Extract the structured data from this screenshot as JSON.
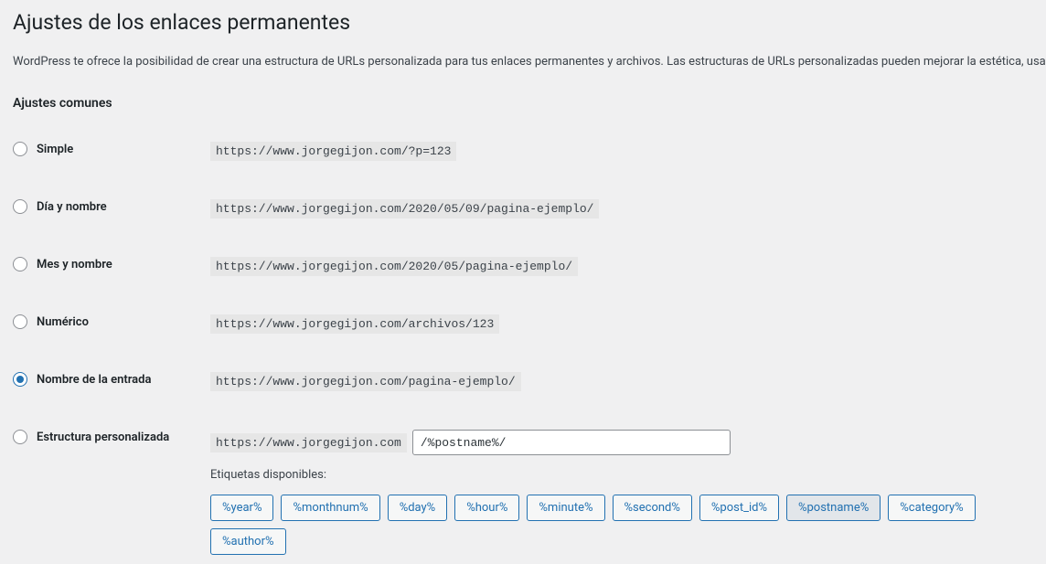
{
  "page": {
    "title": "Ajustes de los enlaces permanentes",
    "description": "WordPress te ofrece la posibilidad de crear una estructura de URLs personalizada para tus enlaces permanentes y archivos. Las estructuras de URLs personalizadas pueden mejorar la estética, usabilidad y compatibilidad futura de tus enlaces. Hay disponibles varias etiquetas, y aquí tienes algunos ejemplos para empezar.",
    "section_title": "Ajustes comunes"
  },
  "options": [
    {
      "label": "Simple",
      "url": "https://www.jorgegijon.com/?p=123",
      "selected": false
    },
    {
      "label": "Día y nombre",
      "url": "https://www.jorgegijon.com/2020/05/09/pagina-ejemplo/",
      "selected": false
    },
    {
      "label": "Mes y nombre",
      "url": "https://www.jorgegijon.com/2020/05/pagina-ejemplo/",
      "selected": false
    },
    {
      "label": "Numérico",
      "url": "https://www.jorgegijon.com/archivos/123",
      "selected": false
    },
    {
      "label": "Nombre de la entrada",
      "url": "https://www.jorgegijon.com/pagina-ejemplo/",
      "selected": true
    }
  ],
  "custom": {
    "label": "Estructura personalizada",
    "base_url": "https://www.jorgegijon.com",
    "value": "/%postname%/",
    "tags_label": "Etiquetas disponibles:"
  },
  "tags": [
    {
      "label": "%year%",
      "active": false
    },
    {
      "label": "%monthnum%",
      "active": false
    },
    {
      "label": "%day%",
      "active": false
    },
    {
      "label": "%hour%",
      "active": false
    },
    {
      "label": "%minute%",
      "active": false
    },
    {
      "label": "%second%",
      "active": false
    },
    {
      "label": "%post_id%",
      "active": false
    },
    {
      "label": "%postname%",
      "active": true
    },
    {
      "label": "%category%",
      "active": false
    },
    {
      "label": "%author%",
      "active": false
    }
  ]
}
